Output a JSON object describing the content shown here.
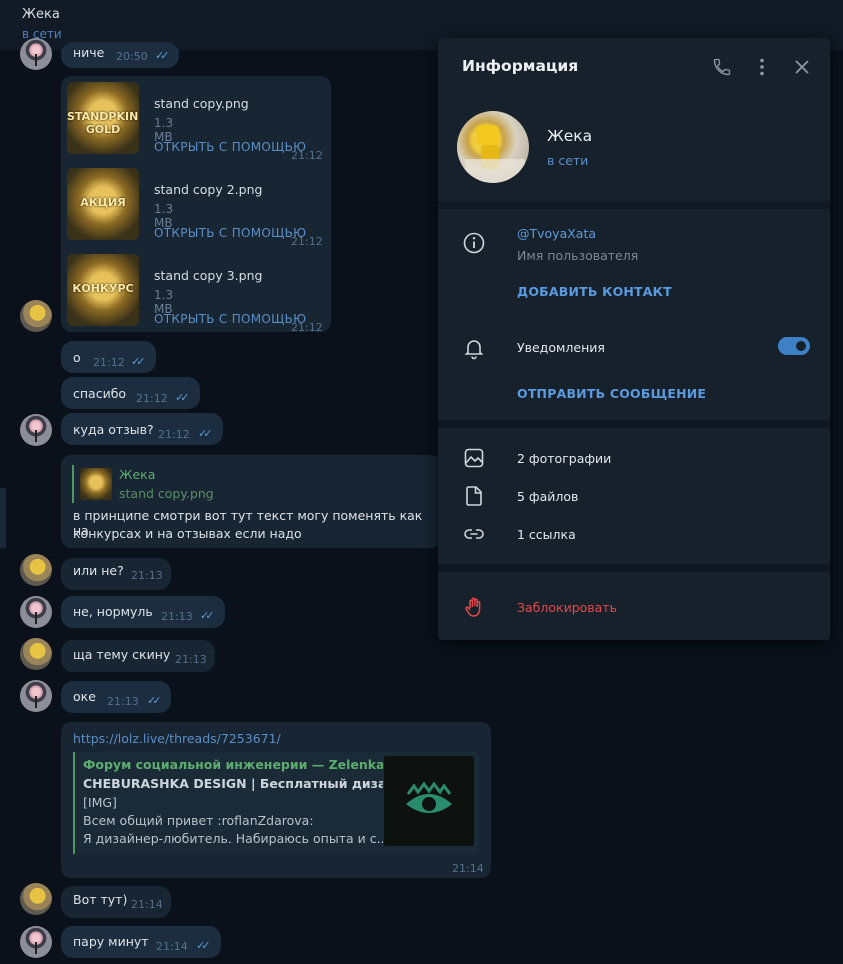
{
  "header": {
    "name": "Жека",
    "status": "в сети"
  },
  "messages": {
    "m0": {
      "text": "ниче",
      "time": "20:50"
    },
    "files": [
      {
        "thumb_label": "STANDPKING GOLD",
        "name": "stand copy.png",
        "size": "1.3 MB",
        "action": "ОТКРЫТЬ С ПОМОЩЬЮ",
        "time": "21:12"
      },
      {
        "thumb_label": "АКЦИЯ",
        "name": "stand copy 2.png",
        "size": "1.3 MB",
        "action": "ОТКРЫТЬ С ПОМОЩЬЮ",
        "time": "21:12"
      },
      {
        "thumb_label": "КОНКУРС",
        "name": "stand copy 3.png",
        "size": "1.3 MB",
        "action": "ОТКРЫТЬ С ПОМОЩЬЮ",
        "time": "21:12"
      }
    ],
    "m1": {
      "text": "о",
      "time": "21:12"
    },
    "m2": {
      "text": "спасибо",
      "time": "21:12"
    },
    "m3": {
      "text": "куда отзыв?",
      "time": "21:12"
    },
    "m4": {
      "reply_name": "Жека",
      "reply_sub": "stand copy.png",
      "line1": "в принципе смотри вот тут текст могу поменять как на",
      "line2": "конкурсах и на отзывах если надо"
    },
    "m5": {
      "text": "или не?",
      "time": "21:13"
    },
    "m6": {
      "text": "не, нормуль",
      "time": "21:13"
    },
    "m7": {
      "text": "ща тему скину",
      "time": "21:13"
    },
    "m8": {
      "text": "оке",
      "time": "21:13"
    },
    "m9": {
      "url": "https://lolz.live/threads/7253671/",
      "site": "Форум социальной инженерии — Zelenka....",
      "title": "CHEBURASHKA DESIGN | Бесплатный дизайн",
      "line1": "[IMG]",
      "line2": "Всем общий привет :roflanZdarova:",
      "line3": "Я дизайнер-любитель. Набираюсь опыта и с...",
      "time": "21:14"
    },
    "m10": {
      "text": "Вот тут)",
      "time": "21:14"
    },
    "m11": {
      "text": "пару минут",
      "time": "21:14"
    },
    "ticks": "✓✓"
  },
  "panel": {
    "title": "Информация",
    "name": "Жека",
    "status": "в сети",
    "username": "@TvoyaXata",
    "username_label": "Имя пользователя",
    "add_contact": "ДОБАВИТЬ КОНТАКТ",
    "notifications": "Уведомления",
    "notifications_on": true,
    "send_message": "ОТПРАВИТЬ СООБЩЕНИЕ",
    "photos": "2 фотографии",
    "files": "5 файлов",
    "links": "1 ссылка",
    "block": "Заблокировать",
    "icons": [
      "phone-icon",
      "more-vertical-icon",
      "close-icon",
      "info-icon",
      "bell-icon",
      "image-icon",
      "file-icon",
      "link-icon",
      "block-hand-icon"
    ]
  },
  "colors": {
    "accent": "#5a9be0",
    "danger": "#e4484b",
    "online": "#4e83bf",
    "quote": "#5cae6e"
  }
}
